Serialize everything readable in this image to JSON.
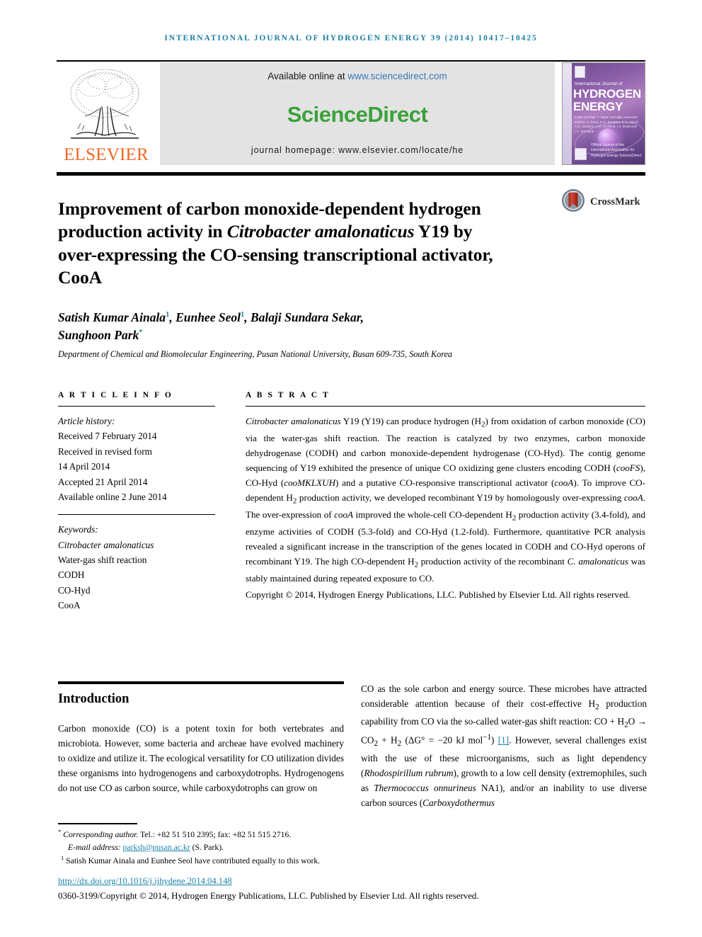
{
  "running_head": "International Journal of Hydrogen Energy 39 (2014) 10417–10425",
  "masthead": {
    "available_prefix": "Available online at ",
    "available_url": "www.sciencedirect.com",
    "sciencedirect_logo": "ScienceDirect",
    "journal_homepage": "journal homepage: www.elsevier.com/locate/he",
    "publisher_name": "ELSEVIER",
    "publisher_icon": "elsevier-tree-icon",
    "cover": {
      "line_sub": "International Journal of",
      "line_1": "HYDROGEN",
      "line_2": "ENERGY",
      "editors": "Editor-in-Chief: T. Nejat Veziroğlu   Associate Editors: S. Dutta, D.G. Bandara, S. A. Sherif, A.G. Dunikov, J.W. Sheffield, I.A. Ersel and I.A. Sarivalda",
      "bottom_note": "Official Journal of the International Association for Hydrogen Energy   ScienceDirect"
    }
  },
  "crossmark": {
    "label": "CrossMark",
    "icon": "crossmark-icon"
  },
  "title": {
    "part1": "Improvement of carbon monoxide-dependent hydrogen production activity in ",
    "italic1": "Citrobacter amalonaticus",
    "part2": " Y19 by over-expressing the CO-sensing transcriptional activator, CooA"
  },
  "authors": {
    "a1": "Satish Kumar Ainala",
    "a1_sup": "1",
    "a2": "Eunhee Seol",
    "a2_sup": "1",
    "a3": "Balaji Sundara Sekar",
    "a4": "Sunghoon Park",
    "a4_sup": "*",
    "affiliation": "Department of Chemical and Biomolecular Engineering, Pusan National University, Busan 609-735, South Korea"
  },
  "article_info": {
    "heading": "A R T I C L E   I N F O",
    "history_label": "Article history:",
    "history": [
      "Received 7 February 2014",
      "Received in revised form",
      "14 April 2014",
      "Accepted 21 April 2014",
      "Available online 2 June 2014"
    ],
    "keywords_label": "Keywords:",
    "keywords": [
      "Citrobacter amalonaticus",
      "Water-gas shift reaction",
      "CODH",
      "CO-Hyd",
      "CooA"
    ]
  },
  "abstract": {
    "heading": "A B S T R A C T",
    "p_a": "Citrobacter amalonaticus",
    "p_b": " Y19 (Y19) can produce hydrogen (H",
    "p_b2": "2",
    "p_c": ") from oxidation of carbon monoxide (CO) via the water-gas shift reaction. The reaction is catalyzed by two enzymes, carbon monoxide dehydrogenase (CODH) and carbon monoxide-dependent hydrogenase (CO-Hyd). The contig genome sequencing of Y19 exhibited the presence of unique CO oxidizing gene clusters encoding CODH (",
    "i_coofs": "cooFS",
    "p_d": "), CO-Hyd (",
    "i_coomklxuh": "cooMKLXUH",
    "p_e": ") and a putative CO-responsive transcriptional activator (",
    "i_cooa": "cooA",
    "p_f": "). To improve CO-dependent H",
    "p_f2": "2",
    "p_g": " production activity, we developed recombinant Y19 by homologously over-expressing ",
    "i_cooa2": "cooA",
    "p_h": ". The over-expression of ",
    "i_cooa3": "cooA",
    "p_i": " improved the whole-cell CO-dependent H",
    "p_i2": "2",
    "p_j": " production activity (3.4-fold), and enzyme activities of CODH (5.3-fold) and CO-Hyd (1.2-fold). Furthermore, quantitative PCR analysis revealed a significant increase in the transcription of the genes located in CODH and CO-Hyd operons of recombinant Y19. The high CO-dependent H",
    "p_j2": "2",
    "p_k": " production activity of the recombinant ",
    "i_camal": "C. amalonaticus",
    "p_l": " was stably maintained during repeated exposure to CO.",
    "copyright": "Copyright © 2014, Hydrogen Energy Publications, LLC. Published by Elsevier Ltd. All rights reserved."
  },
  "introduction": {
    "heading": "Introduction",
    "left_text": "Carbon monoxide (CO) is a potent toxin for both vertebrates and microbiota. However, some bacteria and archeae have evolved machinery to oxidize and utilize it. The ecological versatility for CO utilization divides these organisms into hydrogenogens and carboxydotrophs. Hydrogenogens do not use CO as carbon source, while carboxydotrophs can grow on",
    "right_a": "CO as the sole carbon and energy source. These microbes have attracted considerable attention because of their cost-effective H",
    "right_a2": "2",
    "right_b": " production capability from CO via the so-called water-gas shift reaction: CO + H",
    "right_b2": "2",
    "right_c": "O → CO",
    "right_c2": "2",
    "right_d": " + H",
    "right_d2": "2",
    "right_e": " (ΔG° = −20 kJ mol",
    "right_e_sup": "−1",
    "right_f": ") ",
    "right_ref": "[1]",
    "right_g": ". However, several challenges exist with the use of these microorganisms, such as light dependency (",
    "i_rhodo": "Rhodospirillum rubrum",
    "right_h": "), growth to a low cell density (extremophiles, such as ",
    "i_thermo": "Thermococcus onnurineus",
    "right_i": " NA1), and/or an inability to use diverse carbon sources (",
    "i_carboxy": "Carboxydothermus"
  },
  "footnotes": {
    "star": "*",
    "corresponding_italic": "Corresponding author.",
    "corresponding_rest": " Tel.: +82 51 510 2395; fax: +82 51 515 2716.",
    "email_label": "E-mail address: ",
    "email": "parksh@pusan.ac.kr",
    "email_after": " (S. Park).",
    "fn1_sup": "1",
    "fn1": " Satish Kumar Ainala and Eunhee Seol have contributed equally to this work.",
    "doi": "http://dx.doi.org/10.1016/j.ijhydene.2014.04.148",
    "copyright_line": "0360-3199/Copyright © 2014, Hydrogen Energy Publications, LLC. Published by Elsevier Ltd. All rights reserved."
  },
  "colors": {
    "accent_blue": "#1a7fa8",
    "link_blue": "#3a78b5",
    "sd_green": "#3aa23a",
    "elsevier_orange": "#ef6723",
    "panel_gray": "#e3e3e3"
  }
}
